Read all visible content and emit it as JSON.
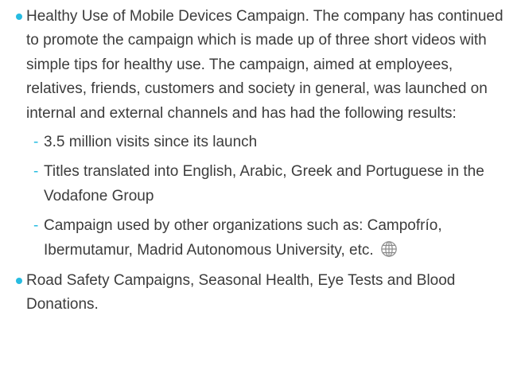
{
  "colors": {
    "accent": "#27bce1",
    "text": "#3c3c3c",
    "icon": "#8a8a8a"
  },
  "items": [
    {
      "text": "Healthy Use of Mobile Devices Campaign. The company has continued to promote the campaign which is made up of three short videos with simple tips for healthy use. The campaign, aimed at employees, relatives, friends, customers and society in general, was launched on internal and external channels and has had the following results:",
      "subitems": [
        "3.5 million visits since its launch",
        "Titles translated into English, Arabic, Greek and Portuguese in the Vodafone Group",
        "Campaign used by other organizations such as: Campofrío, Ibermutamur, Madrid Autonomous University, etc."
      ]
    },
    {
      "text": "Road Safety Campaigns, Seasonal Health, Eye Tests and Blood Donations."
    }
  ],
  "icons": {
    "web_link": "globe-icon"
  },
  "dash_glyph": "-"
}
